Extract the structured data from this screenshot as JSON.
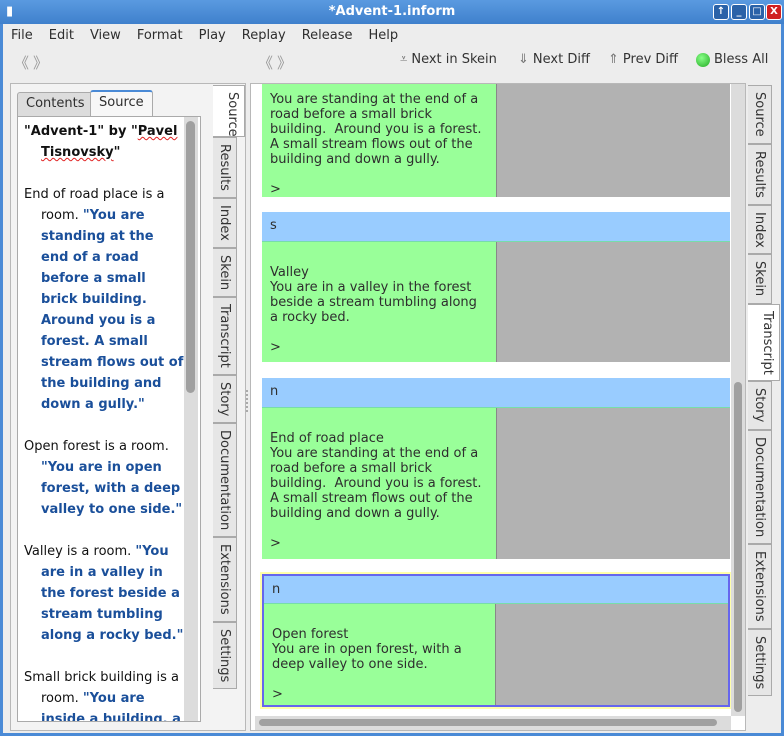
{
  "window": {
    "title": "*Advent-1.inform"
  },
  "menu": [
    "File",
    "Edit",
    "View",
    "Format",
    "Play",
    "Replay",
    "Release",
    "Help"
  ],
  "toolbar": {
    "next_in_skein": "Next in Skein",
    "next_diff": "Next Diff",
    "prev_diff": "Prev Diff",
    "bless_all": "Bless All"
  },
  "left": {
    "tabs": [
      "Contents",
      "Source"
    ],
    "source": {
      "title_a": "\"Advent-1\" by \"",
      "title_b": "Pavel",
      "title_c": " ",
      "title_d": "Tisnovsky",
      "title_e": "\"",
      "paras": [
        {
          "text": "End of road place is a room. ",
          "quote": "\"You are standing at the end of a road before a small brick building. Around you is a forest. A small stream flows out of the building and down a gully.\""
        },
        {
          "text": "Open forest is a room. ",
          "quote": "\"You are in open forest, with a deep valley to one side.\""
        },
        {
          "text": "Valley is a room. ",
          "quote": "\"You are in a valley in the forest beside a stream tumbling along a rocky bed.\""
        },
        {
          "text": "Small brick building is a room. ",
          "quote": "\"You are inside a building, a well house for a"
        }
      ]
    },
    "side_tabs": [
      "Source",
      "Results",
      "Index",
      "Skein",
      "Transcript",
      "Story",
      "Documentation",
      "Extensions",
      "Settings"
    ]
  },
  "right": {
    "side_tabs": [
      "Source",
      "Results",
      "Index",
      "Skein",
      "Transcript",
      "Story",
      "Documentation",
      "Extensions",
      "Settings"
    ],
    "transcript": [
      {
        "command": "",
        "output": "You are standing at the end of a\nroad before a small brick\nbuilding.  Around you is a forest.\nA small stream flows out of the\nbuilding and down a gully.\n\n>"
      },
      {
        "command": "s",
        "output": "\nValley\nYou are in a valley in the forest\nbeside a stream tumbling along\na rocky bed.\n\n>"
      },
      {
        "command": "n",
        "output": "\nEnd of road place\nYou are standing at the end of a\nroad before a small brick\nbuilding.  Around you is a forest.\nA small stream flows out of the\nbuilding and down a gully.\n\n>"
      },
      {
        "command": "n",
        "output": "\nOpen forest\nYou are in open forest, with a\ndeep valley to one side.\n\n>"
      }
    ]
  }
}
